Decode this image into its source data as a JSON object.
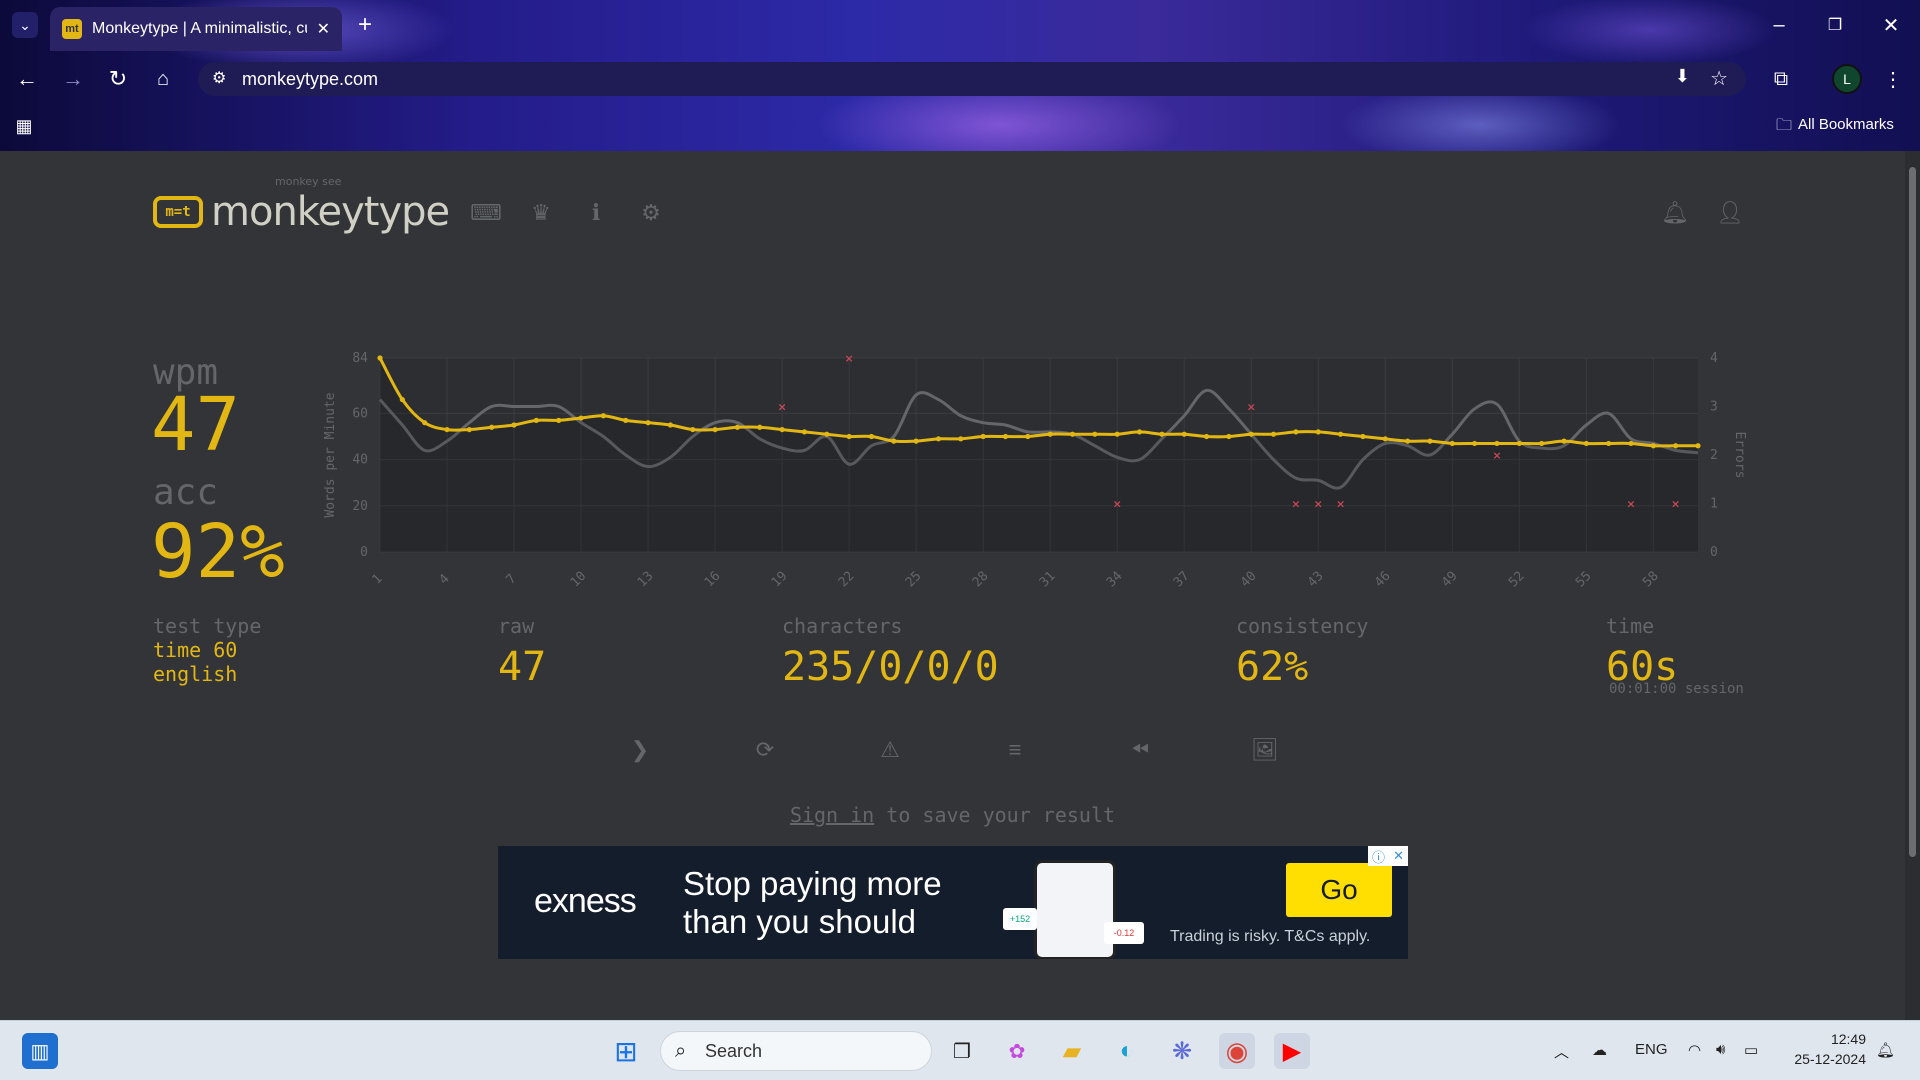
{
  "browser": {
    "tab_title": "Monkeytype | A minimalistic, cu",
    "favicon_text": "mt",
    "url": "monkeytype.com",
    "all_bookmarks": "All Bookmarks",
    "profile_initial": "L"
  },
  "site": {
    "logo_sub": "monkey see",
    "logo_text": "monkeytype",
    "logo_mark": "m=t"
  },
  "results": {
    "wpm_label": "wpm",
    "wpm": "47",
    "acc_label": "acc",
    "acc": "92%",
    "test_type_label": "test type",
    "test_type_line1": "time 60",
    "test_type_line2": "english",
    "raw_label": "raw",
    "raw": "47",
    "characters_label": "characters",
    "characters": "235/0/0/0",
    "consistency_label": "consistency",
    "consistency": "62%",
    "time_label": "time",
    "time": "60s",
    "session": "00:01:00 session",
    "signin_link": "Sign in",
    "signin_rest": " to save your result"
  },
  "chart_data": {
    "type": "line",
    "ylabel": "Words per Minute",
    "y2label": "Errors",
    "ylim": [
      0,
      84
    ],
    "y2lim": [
      0,
      4
    ],
    "yticks": [
      "0",
      "20",
      "40",
      "60",
      "84"
    ],
    "y2ticks": [
      "0",
      "1",
      "2",
      "3",
      "4"
    ],
    "xticks": [
      "1",
      "4",
      "7",
      "10",
      "13",
      "16",
      "19",
      "22",
      "25",
      "28",
      "31",
      "34",
      "37",
      "40",
      "43",
      "46",
      "49",
      "52",
      "55",
      "58"
    ],
    "x": [
      1,
      2,
      3,
      4,
      5,
      6,
      7,
      8,
      9,
      10,
      11,
      12,
      13,
      14,
      15,
      16,
      17,
      18,
      19,
      20,
      21,
      22,
      23,
      24,
      25,
      26,
      27,
      28,
      29,
      30,
      31,
      32,
      33,
      34,
      35,
      36,
      37,
      38,
      39,
      40,
      41,
      42,
      43,
      44,
      45,
      46,
      47,
      48,
      49,
      50,
      51,
      52,
      53,
      54,
      55,
      56,
      57,
      58,
      59,
      60
    ],
    "series": [
      {
        "values": [
          84,
          66,
          56,
          53,
          53,
          54,
          55,
          57,
          57,
          58,
          59,
          57,
          56,
          55,
          53,
          53,
          54,
          54,
          53,
          52,
          51,
          50,
          50,
          48,
          48,
          49,
          49,
          50,
          50,
          50,
          51,
          51,
          51,
          51,
          52,
          51,
          51,
          50,
          50,
          51,
          51,
          52,
          52,
          51,
          50,
          49,
          48,
          48,
          47,
          47,
          47,
          47,
          47,
          48,
          47,
          47,
          47,
          46,
          46,
          46
        ]
      },
      {
        "values": [
          66,
          55,
          44,
          48,
          56,
          63,
          63,
          63,
          63,
          56,
          50,
          42,
          37,
          41,
          50,
          56,
          56,
          49,
          45,
          44,
          50,
          38,
          46,
          50,
          68,
          66,
          59,
          56,
          55,
          52,
          52,
          51,
          46,
          41,
          40,
          49,
          59,
          70,
          62,
          51,
          40,
          32,
          31,
          28,
          40,
          47,
          46,
          42,
          51,
          62,
          64,
          48,
          45,
          46,
          55,
          60,
          49,
          47,
          44,
          43
        ]
      }
    ],
    "error_points": [
      [
        19,
        3
      ],
      [
        22,
        4
      ],
      [
        34,
        1
      ],
      [
        40,
        3
      ],
      [
        42,
        1
      ],
      [
        43,
        1
      ],
      [
        44,
        1
      ],
      [
        51,
        2
      ],
      [
        57,
        1
      ],
      [
        59,
        1
      ]
    ]
  },
  "ad": {
    "brand": "exness",
    "headline1": "Stop paying more",
    "headline2": "than you should",
    "go": "Go",
    "risk": "Trading is risky. T&Cs apply.",
    "chip1": "+152",
    "chip2": "-0.12"
  },
  "taskbar": {
    "search": "Search",
    "lang": "ENG",
    "time": "12:49",
    "date": "25-12-2024"
  },
  "colors": {
    "accent": "#e2b714",
    "bg": "#323437",
    "sub": "#646669",
    "raw_line": "#646669",
    "error": "#ca4754"
  }
}
